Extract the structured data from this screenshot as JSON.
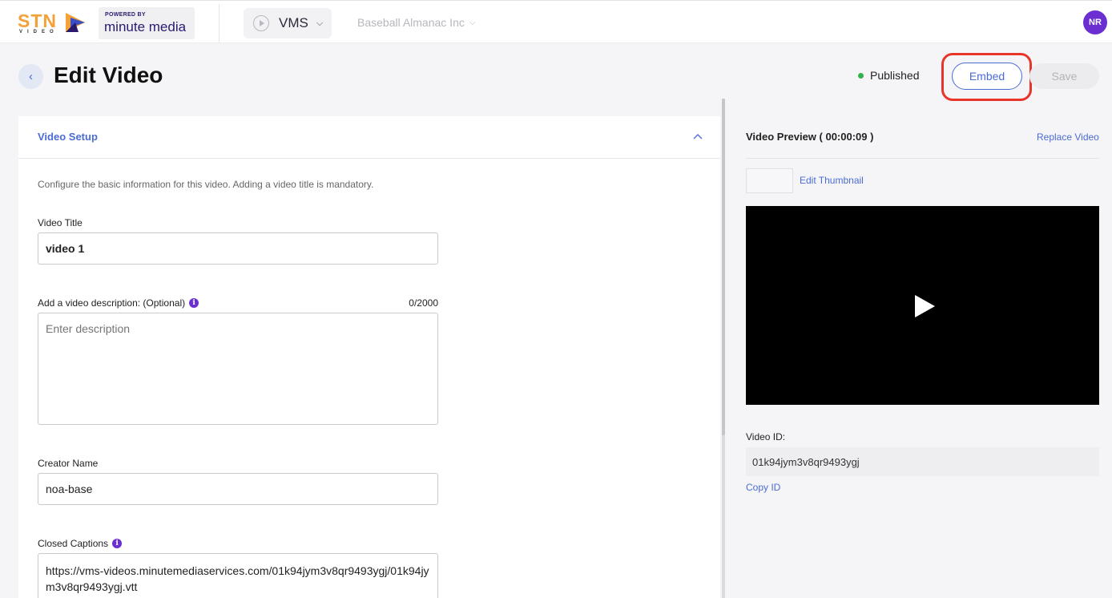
{
  "header": {
    "logo_text": "STN",
    "logo_sub": "VIDEO",
    "powered_by": "POWERED BY",
    "brand": "minute media",
    "app_selector": "VMS",
    "org_selector": "Baseball Almanac Inc",
    "avatar_initials": "NR"
  },
  "page": {
    "title": "Edit Video",
    "status": "Published",
    "embed_label": "Embed",
    "save_label": "Save"
  },
  "video_setup": {
    "section_title": "Video Setup",
    "intro": "Configure the basic information for this video. Adding a video title is mandatory.",
    "title_label": "Video Title",
    "title_value": "video 1",
    "description_label": "Add a video description: (Optional)",
    "description_counter": "0/2000",
    "description_placeholder": "Enter description",
    "creator_label": "Creator Name",
    "creator_value": "noa-base",
    "captions_label": "Closed Captions",
    "captions_value": "https://vms-videos.minutemediaservices.com/01k94jym3v8qr9493ygj/01k94jym3v8qr9493ygj.vtt"
  },
  "preview": {
    "title": "Video Preview ( 00:00:09 )",
    "replace_label": "Replace Video",
    "edit_thumbnail_label": "Edit Thumbnail",
    "video_id_label": "Video ID:",
    "video_id": "01k94jym3v8qr9493ygj",
    "copy_id_label": "Copy ID"
  },
  "colors": {
    "accent": "#4a6cd4",
    "status_published": "#2fb34a",
    "highlight_ring": "#e8352a",
    "avatar": "#6b2fd1"
  }
}
